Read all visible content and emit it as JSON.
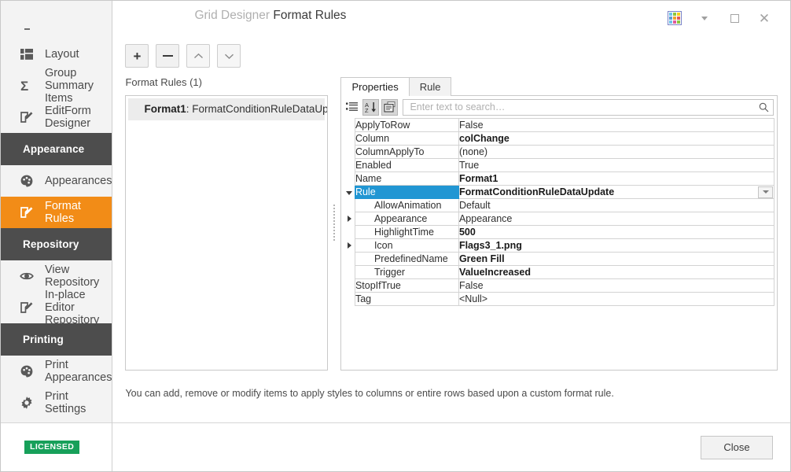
{
  "window": {
    "title_prefix": "Grid Designer",
    "title_main": "Format Rules",
    "grid_icon": "grid-color-icon",
    "dropdown_icon": "chevron-down-icon",
    "maximize_icon": "maximize-icon",
    "close_icon": "close-icon"
  },
  "sidebar": {
    "items": [
      {
        "label": "Layout",
        "icon": "layout-icon",
        "type": "item",
        "active": false
      },
      {
        "label": "Group Summary Items",
        "icon": "sigma-icon",
        "type": "item",
        "active": false
      },
      {
        "label": "EditForm Designer",
        "icon": "edit-form-icon",
        "type": "item",
        "active": false
      },
      {
        "label": "Appearance",
        "icon": "",
        "type": "group",
        "active": false
      },
      {
        "label": "Appearances",
        "icon": "palette-icon",
        "type": "item",
        "active": false
      },
      {
        "label": "Format Rules",
        "icon": "edit-rule-icon",
        "type": "item",
        "active": true
      },
      {
        "label": "Repository",
        "icon": "",
        "type": "group",
        "active": false
      },
      {
        "label": "View Repository",
        "icon": "eye-icon",
        "type": "item",
        "active": false
      },
      {
        "label": "In-place Editor Repository",
        "icon": "edit-form-icon",
        "type": "item",
        "active": false
      },
      {
        "label": "Printing",
        "icon": "",
        "type": "group",
        "active": false
      },
      {
        "label": "Print Appearances",
        "icon": "palette-icon",
        "type": "item",
        "active": false
      },
      {
        "label": "Print Settings",
        "icon": "gear-icon",
        "type": "item",
        "active": false
      }
    ],
    "license_badge": "LICENSED"
  },
  "toolbar": {
    "add_label": "+",
    "remove_label": "−",
    "move_up_icon": "chevron-up-icon",
    "move_down_icon": "chevron-down-icon"
  },
  "rules_pane": {
    "caption": "Format Rules (1)",
    "items": [
      {
        "name": "Format1",
        "separator": ":",
        "rule": "FormatConditionRuleDataUpdate"
      }
    ]
  },
  "properties_pane": {
    "tabs": [
      {
        "label": "Properties",
        "active": true
      },
      {
        "label": "Rule",
        "active": false
      }
    ],
    "toolbar": [
      {
        "icon": "categorized-icon",
        "pressed": false
      },
      {
        "icon": "sort-alphabetical-icon",
        "pressed": true
      },
      {
        "icon": "property-pages-icon",
        "pressed": true
      }
    ],
    "search": {
      "placeholder": "Enter text to search…",
      "value": "",
      "icon": "search-icon"
    },
    "rows": [
      {
        "name": "ApplyToRow",
        "value": "False",
        "indent": 0,
        "bold": false,
        "expander": "",
        "selected": false,
        "editor": false
      },
      {
        "name": "Column",
        "value": "colChange",
        "indent": 0,
        "bold": true,
        "expander": "",
        "selected": false,
        "editor": false
      },
      {
        "name": "ColumnApplyTo",
        "value": "(none)",
        "indent": 0,
        "bold": false,
        "expander": "",
        "selected": false,
        "editor": false
      },
      {
        "name": "Enabled",
        "value": "True",
        "indent": 0,
        "bold": false,
        "expander": "",
        "selected": false,
        "editor": false
      },
      {
        "name": "Name",
        "value": "Format1",
        "indent": 0,
        "bold": true,
        "expander": "",
        "selected": false,
        "editor": false
      },
      {
        "name": "Rule",
        "value": "FormatConditionRuleDataUpdate",
        "indent": 0,
        "bold": true,
        "expander": "down",
        "selected": true,
        "editor": true
      },
      {
        "name": "AllowAnimation",
        "value": "Default",
        "indent": 1,
        "bold": false,
        "expander": "",
        "selected": false,
        "editor": false
      },
      {
        "name": "Appearance",
        "value": "Appearance",
        "indent": 1,
        "bold": false,
        "expander": "right",
        "selected": false,
        "editor": false
      },
      {
        "name": "HighlightTime",
        "value": "500",
        "indent": 1,
        "bold": true,
        "expander": "",
        "selected": false,
        "editor": false
      },
      {
        "name": "Icon",
        "value": "Flags3_1.png",
        "indent": 1,
        "bold": true,
        "expander": "right",
        "selected": false,
        "editor": false
      },
      {
        "name": "PredefinedName",
        "value": "Green Fill",
        "indent": 1,
        "bold": true,
        "expander": "",
        "selected": false,
        "editor": false
      },
      {
        "name": "Trigger",
        "value": "ValueIncreased",
        "indent": 1,
        "bold": true,
        "expander": "",
        "selected": false,
        "editor": false
      },
      {
        "name": "StopIfTrue",
        "value": "False",
        "indent": 0,
        "bold": false,
        "expander": "",
        "selected": false,
        "editor": false
      },
      {
        "name": "Tag",
        "value": "<Null>",
        "indent": 0,
        "bold": false,
        "expander": "",
        "selected": false,
        "editor": false
      }
    ]
  },
  "hint": "You can add, remove or modify items to apply styles to columns or entire rows based upon a custom format rule.",
  "footer": {
    "close_label": "Close"
  },
  "colors": {
    "accent_orange": "#f28c17",
    "group_header": "#4d4d4d",
    "selection_blue": "#2196d3",
    "license_green": "#17a05a",
    "sidebar_bg": "#f3f3f3"
  }
}
